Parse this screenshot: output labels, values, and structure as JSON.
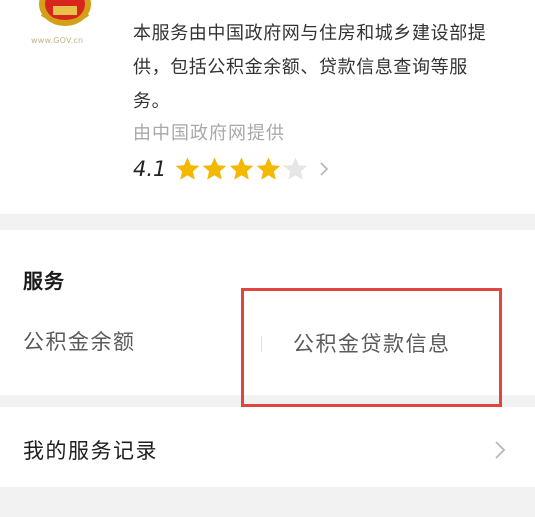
{
  "header": {
    "logo_domain": "www.GOV.cn",
    "title_partial": "",
    "description": "本服务由中国政府网与住房和城乡建设部提供，包括公积金余额、贷款信息查询等服务。",
    "provider": "由中国政府网提供",
    "rating": "4.1",
    "rating_value": 4.1,
    "rating_max": 5
  },
  "services": {
    "section_title": "服务",
    "items": [
      {
        "label": "公积金余额"
      },
      {
        "label": "公积金贷款信息"
      }
    ]
  },
  "records": {
    "label": "我的服务记录"
  },
  "icons": {
    "logo": "national-emblem-icon",
    "star": "star-icon",
    "chevron": "chevron-right-icon"
  },
  "colors": {
    "star": "#f5b800",
    "highlight": "#e0453f",
    "background_gap": "#f2f2f2"
  }
}
